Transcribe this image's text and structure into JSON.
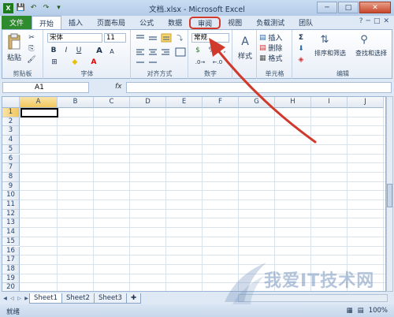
{
  "app": {
    "title": "文档.xlsx - Microsoft Excel"
  },
  "window_controls": {
    "minimize": "─",
    "maximize": "□",
    "close": "✕"
  },
  "quick_access": {
    "save": "💾",
    "undo": "↶",
    "redo": "↷",
    "more": "▾"
  },
  "tabs": {
    "file": "文件",
    "home": "开始",
    "insert": "插入",
    "page_layout": "页面布局",
    "formulas": "公式",
    "data": "数据",
    "review": "审阅",
    "view": "视图",
    "load_test": "负载测试",
    "team": "团队"
  },
  "tab_right_icons": {
    "help": "?",
    "min": "─",
    "restore": "□",
    "close": "✕"
  },
  "ribbon": {
    "clipboard": {
      "paste": "粘贴",
      "label": "剪贴板"
    },
    "font": {
      "family": "宋体",
      "size": "11",
      "bold": "B",
      "italic": "I",
      "underline": "U",
      "grow": "A",
      "shrink": "A",
      "label": "字体"
    },
    "alignment": {
      "label": "对齐方式"
    },
    "number": {
      "format": "常规",
      "percent": "%",
      "label": "数字"
    },
    "styles": {
      "styles_btn": "样式"
    },
    "cells": {
      "insert": "插入",
      "delete": "删除",
      "format": "格式",
      "label": "单元格"
    },
    "editing": {
      "sum": "Σ",
      "sort_filter": "排序和筛选",
      "find_select": "查找和选择",
      "label": "编辑"
    }
  },
  "formula_bar": {
    "name_box": "A1",
    "fx": "fx",
    "value": ""
  },
  "grid": {
    "columns": [
      "A",
      "B",
      "C",
      "D",
      "E",
      "F",
      "G",
      "H",
      "I",
      "J"
    ],
    "rows": [
      "1",
      "2",
      "3",
      "4",
      "5",
      "6",
      "7",
      "8",
      "9",
      "10",
      "11",
      "12",
      "13",
      "14",
      "15",
      "16",
      "17",
      "18",
      "19",
      "20"
    ]
  },
  "sheets": [
    "Sheet1",
    "Sheet2",
    "Sheet3"
  ],
  "status": {
    "mode": "就绪",
    "zoom": "100%"
  },
  "watermark": {
    "text": "我爱IT技术网"
  },
  "colors": {
    "file_tab": "#2e8b2e",
    "highlight_red": "#d03a2c"
  }
}
